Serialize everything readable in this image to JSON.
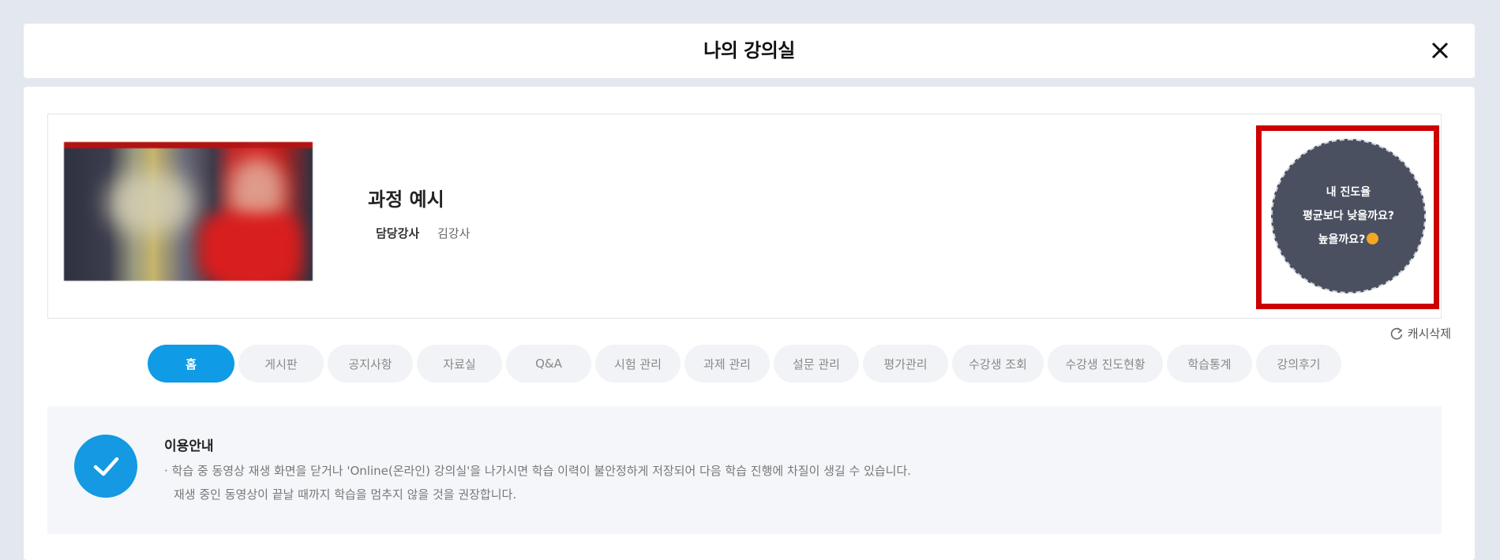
{
  "header": {
    "title": "나의 강의실",
    "close_icon": "close-icon"
  },
  "course": {
    "title": "과정 예시",
    "instructor_label": "담당강사",
    "instructor_name": "김강사",
    "thumbnail_icon": "course-thumbnail"
  },
  "progress_prompt": {
    "line1": "내 진도율",
    "line2": "평균보다 낮을까요?",
    "line3": "높을까요?",
    "emoji_icon": "flushed-face-emoji-icon",
    "highlight_color": "#cc0000"
  },
  "cache": {
    "label": "캐시삭제",
    "icon": "refresh-icon"
  },
  "tabs": [
    {
      "label": "홈",
      "active": true
    },
    {
      "label": "게시판"
    },
    {
      "label": "공지사항"
    },
    {
      "label": "자료실"
    },
    {
      "label": "Q&A"
    },
    {
      "label": "시험 관리"
    },
    {
      "label": "과제 관리"
    },
    {
      "label": "설문 관리"
    },
    {
      "label": "평가관리"
    },
    {
      "label": "수강생 조회"
    },
    {
      "label": "수강생 진도현황"
    },
    {
      "label": "학습통계"
    },
    {
      "label": "강의후기"
    }
  ],
  "notice": {
    "title": "이용안내",
    "line1": "· 학습 중 동영상 재생 화면을 닫거나 'Online(온라인) 강의실'을 나가시면 학습 이력이 불안정하게 저장되어 다음 학습 진행에 차질이 생길 수 있습니다.",
    "line2": "재생 중인 동영상이 끝날 때까지 학습을 멈추지 않을 것을 권장합니다.",
    "icon": "check-icon"
  },
  "colors": {
    "accent": "#0f9be6",
    "circle_bg": "#4a5060"
  }
}
